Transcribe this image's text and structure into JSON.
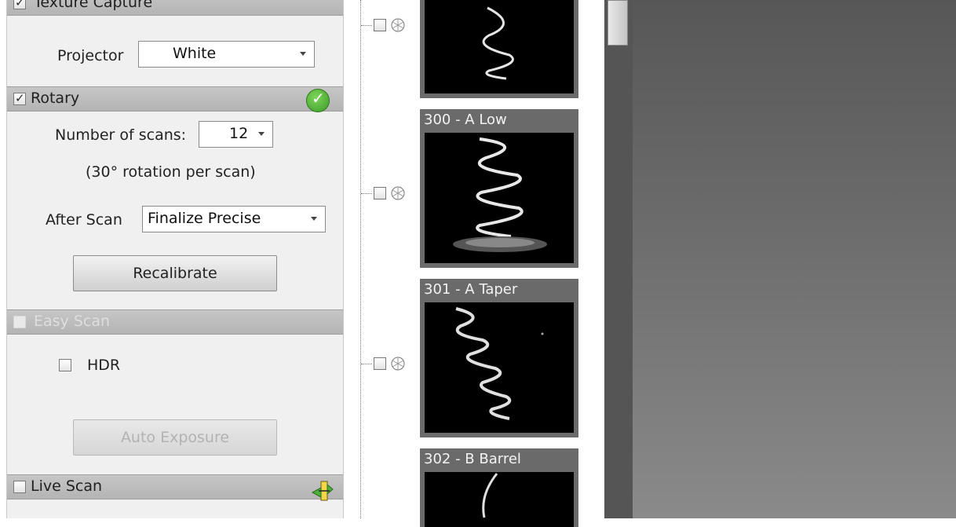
{
  "texture_capture": {
    "title": "Texture Capture",
    "checked": true,
    "projector_label": "Projector",
    "projector_value": "White"
  },
  "rotary": {
    "title": "Rotary",
    "checked": true,
    "status_icon": "green-check-icon",
    "scans_label": "Number of scans:",
    "scans_value": "12",
    "rotation_note": "(30° rotation per scan)",
    "after_scan_label": "After Scan",
    "after_scan_value": "Finalize Precise",
    "recalibrate_label": "Recalibrate"
  },
  "easy_scan": {
    "title": "Easy Scan",
    "checked": false,
    "disabled": true,
    "hdr_label": "HDR",
    "hdr_checked": false,
    "auto_exposure_label": "Auto Exposure"
  },
  "live_scan": {
    "title": "Live Scan",
    "checked": false,
    "icon": "live-scan-icon"
  },
  "scans": [
    {
      "label": ""
    },
    {
      "label": "300 - A Low"
    },
    {
      "label": "301 - A Taper"
    },
    {
      "label": "302 - B Barrel"
    }
  ],
  "colors": {
    "panel_bg": "#f0f0f0",
    "section_header": "#bdbdbd",
    "thumb_frame": "#6a6a6a",
    "viewport_top": "#575757",
    "viewport_bottom": "#8a8a8a",
    "ok_green": "#4caf3a"
  }
}
